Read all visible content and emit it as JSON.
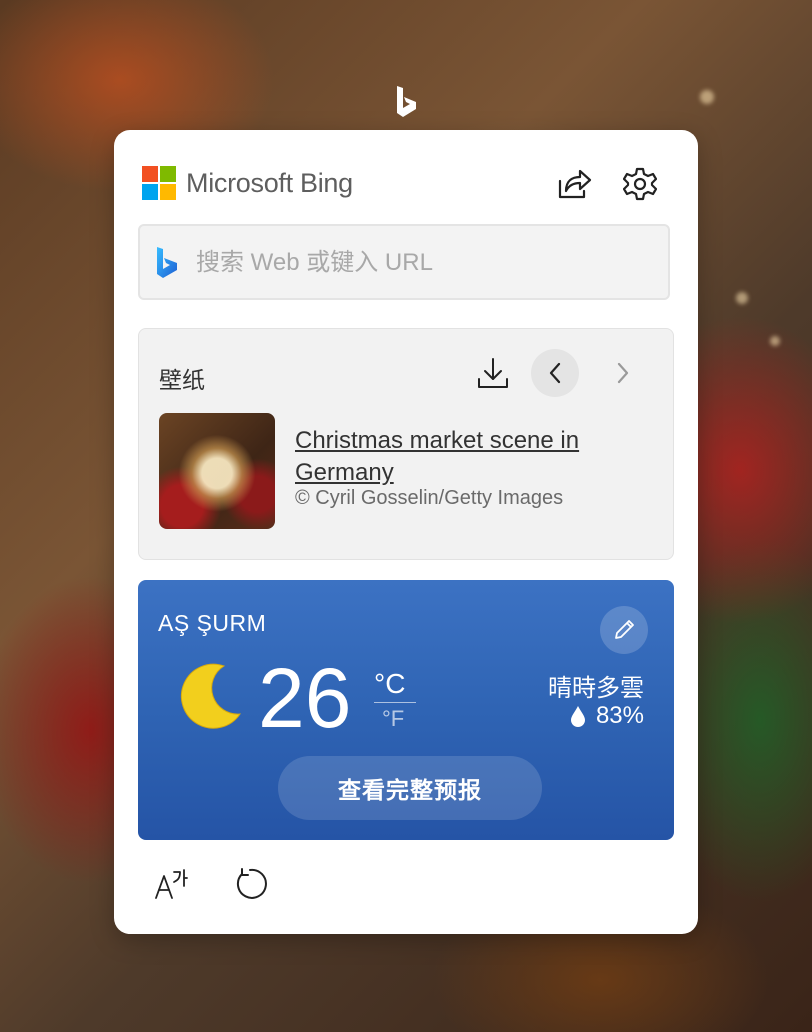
{
  "brand": {
    "name": "Microsoft Bing"
  },
  "header": {
    "share_icon": "share-icon",
    "settings_icon": "gear-icon"
  },
  "search": {
    "placeholder": "搜索 Web 或键入 URL",
    "icon": "bing-icon"
  },
  "wallpaper": {
    "title": "壁纸",
    "caption": "Christmas market scene in Germany",
    "credit": "© Cyril Gosselin/Getty Images",
    "icons": [
      "download-icon",
      "chevron-left-icon",
      "chevron-right-icon"
    ]
  },
  "weather": {
    "location": "AŞ ŞURM",
    "temperature": "26",
    "unit_c": "°C",
    "unit_f": "°F",
    "condition": "晴時多雲",
    "humidity": "83%",
    "forecast_button": "查看完整预报",
    "icon": "moon-icon"
  },
  "footer": {
    "icons": [
      "translate-icon",
      "refresh-icon"
    ]
  },
  "colors": {
    "weather_bg": "#2f64b4",
    "moon": "#f2cf1d",
    "bing_blue": "#1a73e8"
  }
}
